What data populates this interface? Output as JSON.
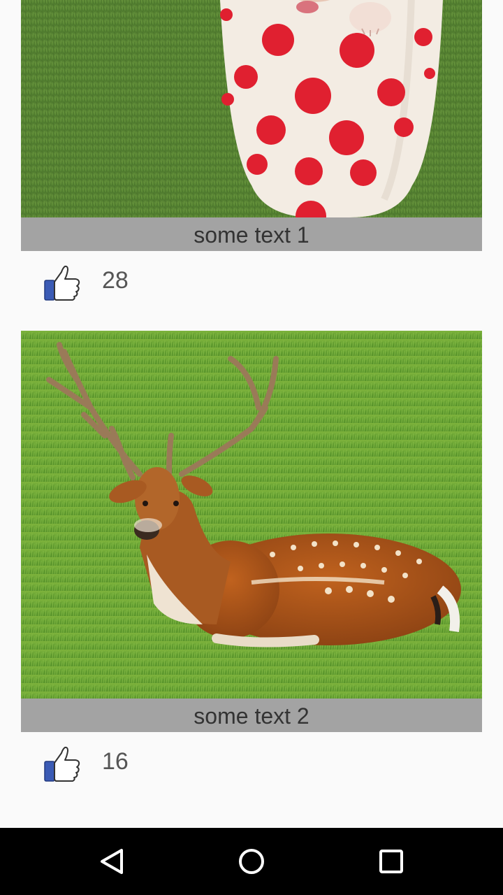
{
  "feed": {
    "posts": [
      {
        "image": "puppy-in-polka-dot-mug",
        "caption": "some text 1",
        "likes": "28"
      },
      {
        "image": "fallow-deer-resting-on-grass",
        "caption": "some text 2",
        "likes": "16"
      }
    ]
  },
  "icons": {
    "like": "thumbs-up-icon",
    "back": "back-triangle-icon",
    "home": "home-circle-icon",
    "recents": "recents-square-icon"
  },
  "colors": {
    "caption_bar": "#a3a3a3",
    "thumb_cuff": "#3b5bb5",
    "nav_bar": "#000000",
    "background": "#fafafa"
  }
}
